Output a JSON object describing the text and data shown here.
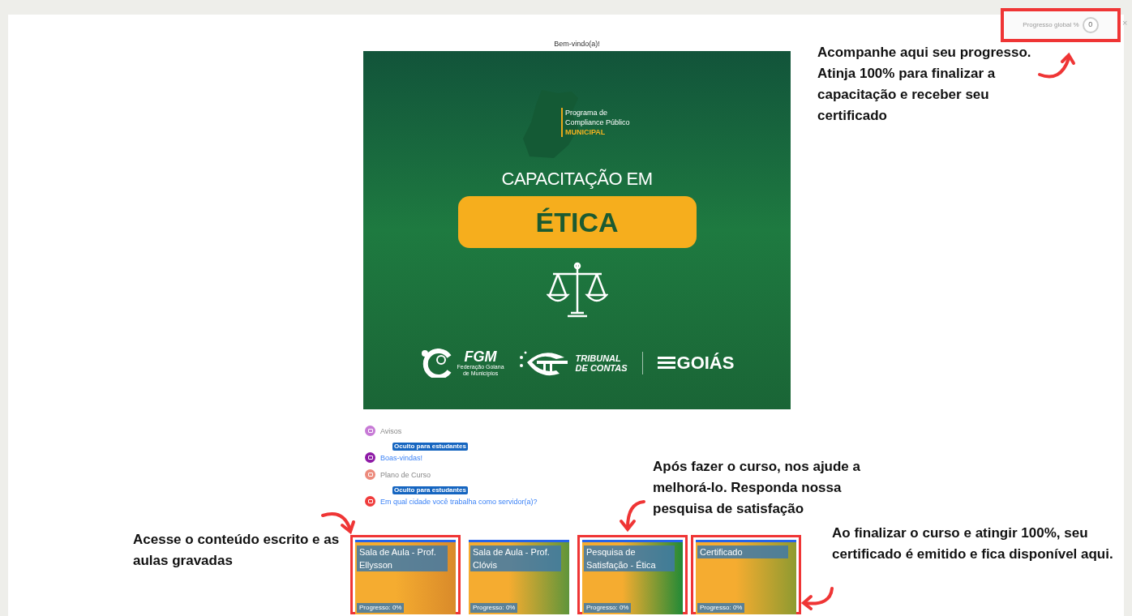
{
  "progress": {
    "label": "Progresso global %",
    "value": "0",
    "close": "×",
    "highlighted": true
  },
  "welcome": "Bem-vindo(a)!",
  "banner": {
    "program_lines": [
      "Programa de",
      "Compliance Público"
    ],
    "program_highlight": "MUNICIPAL",
    "heading": "CAPACITAÇÃO EM",
    "highlight": "ÉTICA",
    "logos": {
      "fgm": "FGM",
      "fgm_caption": [
        "Federação Goiana",
        "de Municípios"
      ],
      "tribunal": [
        "TRIBUNAL",
        "DE CONTAS"
      ],
      "goias": "GOIÁS"
    }
  },
  "activities": [
    {
      "label": "Avisos",
      "color": "#c77ad6",
      "link": false
    },
    {
      "badge": "Oculto para estudantes",
      "label": "Boas-vindas!",
      "color": "#8e1aa6",
      "link": true
    },
    {
      "label": "Plano de Curso",
      "color": "#ec8a7c",
      "link": false
    },
    {
      "badge": "Oculto para estudantes",
      "label": "Em qual cidade você trabalha como servidor(a)?",
      "color": "#f03c3c",
      "link": true
    }
  ],
  "cards": [
    {
      "title": "Sala de Aula - Prof. Ellysson",
      "progress": "Progresso: 0%",
      "color": "#d98a2a",
      "highlighted": true
    },
    {
      "title": "Sala de Aula - Prof. Clóvis",
      "progress": "Progresso: 0%",
      "color": "#5f953a",
      "highlighted": false
    },
    {
      "title": "Pesquisa de Satisfação - Ética",
      "progress": "Progresso: 0%",
      "color": "#228a36",
      "highlighted": true
    },
    {
      "title": "Certificado",
      "progress": "Progresso: 0%",
      "color": "#8e9a30",
      "highlighted": true
    }
  ],
  "notes": [
    "Acompanhe aqui seu progresso. Atinja 100% para finalizar a capacitação e receber seu certificado",
    "Após fazer o curso, nos ajude a melhorá-lo. Responda nossa pesquisa de satisfação",
    "Acesse o conteúdo escrito e as aulas gravadas",
    "Ao finalizar o curso e atingir 100%, seu certificado é emitido e fica disponível aqui."
  ]
}
